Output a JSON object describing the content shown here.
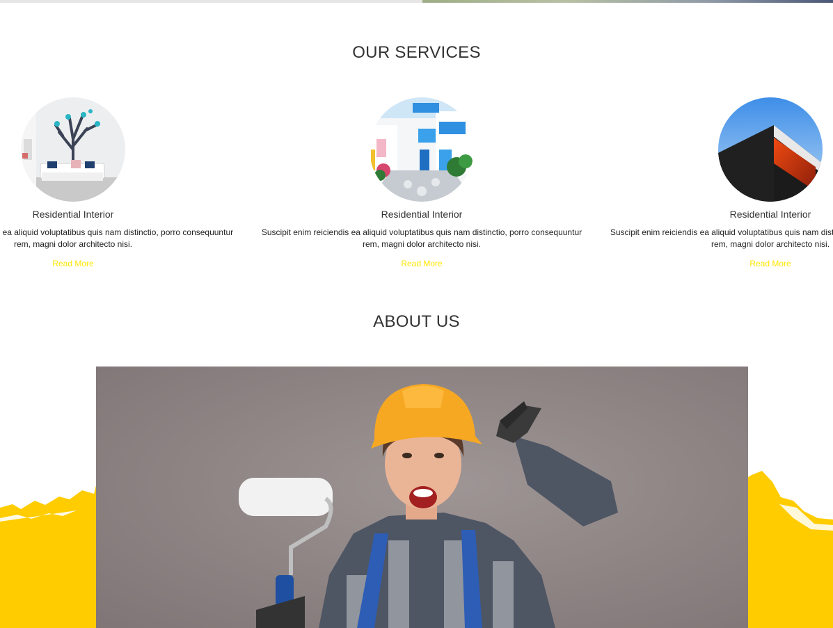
{
  "services": {
    "title": "OUR SERVICES",
    "items": [
      {
        "name": "Residential Interior",
        "description": "Suscipit enim reiciendis ea aliquid voluptatibus quis nam distinctio, porro consequuntur rem, magni dolor architecto nisi.",
        "link": "Read More",
        "image": "living-room-tree-mural"
      },
      {
        "name": "Residential Interior",
        "description": "Suscipit enim reiciendis ea aliquid voluptatibus quis nam distinctio, porro consequuntur rem, magni dolor architecto nisi.",
        "link": "Read More",
        "image": "white-blue-alley-houses"
      },
      {
        "name": "Residential Interior",
        "description": "Suscipit enim reiciendis ea aliquid voluptatibus quis nam distinctio, porro consequuntur rem, magni dolor architecto nisi.",
        "link": "Read More",
        "image": "modern-building-facade"
      }
    ]
  },
  "about": {
    "title": "ABOUT US",
    "image": "woman-worker-hard-hat-paint-roller"
  },
  "colors": {
    "accent": "#ffe600",
    "paint": "#ffcc00",
    "text": "#333333"
  }
}
